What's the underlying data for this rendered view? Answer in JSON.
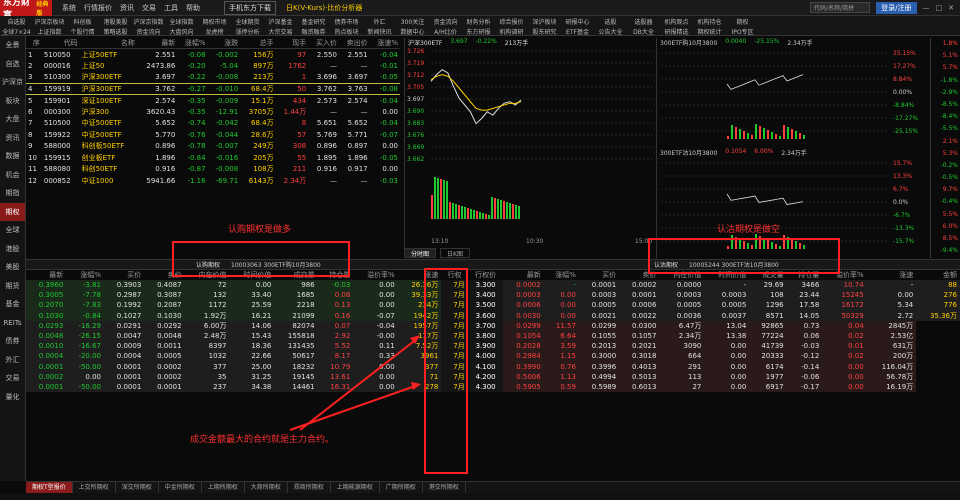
{
  "app": {
    "logo": "东方财富",
    "edition": "经典版",
    "menu": [
      "系统",
      "行情报价",
      "资讯",
      "交易",
      "工具",
      "帮助"
    ],
    "mobile": "手机东方下载",
    "promo": "日K(V-Kurs)·比价分析器",
    "search_placeholder": "代码/名称/简拼",
    "login": "登录/注册"
  },
  "toolbar": {
    "row1": [
      "自选股",
      "沪深京板块",
      "科创板",
      "港股美股",
      "沪深京指数",
      "全球指数",
      "期权市场",
      "全球期货",
      "沪深基金",
      "基金研究",
      "债券市场",
      "外汇",
      "300关注",
      "资金流向",
      "财务分析",
      "综合报价",
      "深沪板块",
      "研报中心",
      "选股",
      "选股器",
      "机构观点",
      "机构持仓",
      "期权"
    ],
    "row2": [
      "全球7×24",
      "上证指数",
      "个股行情",
      "策略选股",
      "资金流向",
      "大盘风向",
      "龙虎榜",
      "涨停分析",
      "大宗交易",
      "融资融券",
      "热点板块",
      "新闻快讯",
      "数据中心",
      "A/H比价",
      "东方研报",
      "机构调研",
      "股东研究",
      "ETF基金",
      "公告大全",
      "DB大全",
      "研报精选",
      "期权统计",
      "IPO专区"
    ]
  },
  "sidebar": [
    "全景",
    "自选",
    "沪深京",
    "板块",
    "大盘",
    "资讯",
    "数据",
    "机会",
    "期指",
    "期权",
    "全球",
    "港股",
    "美股",
    "期货",
    "基金",
    "REITs",
    "债券",
    "外汇",
    "交易",
    "量化"
  ],
  "watchlist": {
    "columns": [
      "序",
      "代码",
      "名称",
      "最新",
      "涨幅%",
      "涨跌",
      "总手",
      "现手",
      "买入价",
      "卖出价",
      "涨速%"
    ],
    "rows": [
      {
        "no": "1",
        "code": "510050",
        "name": "上证50ETF",
        "price": "2.551",
        "pct": "-0.08",
        "chg": "-0.002",
        "vol": "156万",
        "cur": "97",
        "bid": "2.550",
        "ask": "2.551",
        "spd": "-0.04",
        "dir": "dn"
      },
      {
        "no": "2",
        "code": "000016",
        "name": "上证50",
        "price": "2473.86",
        "pct": "-0.20",
        "chg": "-5.04",
        "vol": "897万",
        "cur": "1762",
        "bid": "—",
        "ask": "—",
        "spd": "-0.01",
        "dir": "dn"
      },
      {
        "no": "3",
        "code": "510300",
        "name": "沪深300ETF",
        "price": "3.697",
        "pct": "-0.22",
        "chg": "-0.008",
        "vol": "213万",
        "cur": "1",
        "bid": "3.696",
        "ask": "3.697",
        "spd": "-0.05",
        "dir": "dn"
      },
      {
        "no": "4",
        "code": "159919",
        "name": "沪深300ETF",
        "price": "3.762",
        "pct": "-0.27",
        "chg": "-0.010",
        "vol": "68.4万",
        "cur": "50",
        "bid": "3.762",
        "ask": "3.763",
        "spd": "-0.08",
        "dir": "dn"
      },
      {
        "no": "5",
        "code": "159901",
        "name": "深证100ETF",
        "price": "2.574",
        "pct": "-0.35",
        "chg": "-0.009",
        "vol": "15.1万",
        "cur": "434",
        "bid": "2.573",
        "ask": "2.574",
        "spd": "-0.04",
        "dir": "dn"
      },
      {
        "no": "6",
        "code": "000300",
        "name": "沪深300",
        "price": "3620.43",
        "pct": "-0.35",
        "chg": "-12.91",
        "vol": "3705万",
        "cur": "1.44万",
        "bid": "—",
        "ask": "—",
        "spd": "0.00",
        "dir": "dn"
      },
      {
        "no": "7",
        "code": "510500",
        "name": "中证500ETF",
        "price": "5.652",
        "pct": "-0.74",
        "chg": "-0.042",
        "vol": "68.4万",
        "cur": "8",
        "bid": "5.651",
        "ask": "5.652",
        "spd": "-0.04",
        "dir": "dn"
      },
      {
        "no": "8",
        "code": "159922",
        "name": "中证500ETF",
        "price": "5.770",
        "pct": "-0.76",
        "chg": "-0.044",
        "vol": "28.6万",
        "cur": "57",
        "bid": "5.769",
        "ask": "5.771",
        "spd": "-0.07",
        "dir": "dn"
      },
      {
        "no": "9",
        "code": "588000",
        "name": "科创板50ETF",
        "price": "0.896",
        "pct": "-0.78",
        "chg": "-0.007",
        "vol": "249万",
        "cur": "308",
        "bid": "0.896",
        "ask": "0.897",
        "spd": "0.00",
        "dir": "dn"
      },
      {
        "no": "10",
        "code": "159915",
        "name": "创业板ETF",
        "price": "1.896",
        "pct": "-0.84",
        "chg": "-0.016",
        "vol": "205万",
        "cur": "55",
        "bid": "1.895",
        "ask": "1.896",
        "spd": "-0.05",
        "dir": "dn"
      },
      {
        "no": "11",
        "code": "588080",
        "name": "科创50ETF",
        "price": "0.916",
        "pct": "-0.87",
        "chg": "-0.008",
        "vol": "108万",
        "cur": "211",
        "bid": "0.916",
        "ask": "0.917",
        "spd": "0.00",
        "dir": "dn"
      },
      {
        "no": "12",
        "code": "000852",
        "name": "中证1000",
        "price": "5941.66",
        "pct": "-1.16",
        "chg": "-69.71",
        "vol": "6143万",
        "cur": "2.34万",
        "bid": "—",
        "ask": "—",
        "spd": "-0.03",
        "dir": "dn"
      }
    ]
  },
  "mini_chart": {
    "header": [
      "沪深300ETF",
      "3.697",
      "-0.22%",
      "213万手"
    ],
    "yticks": [
      "3.726",
      "3.719",
      "3.712",
      "3.705",
      "3.697",
      "3.690",
      "3.683",
      "3.676",
      "3.669",
      "3.662"
    ],
    "xticks": [
      "13:10",
      "10:30",
      "15:00"
    ],
    "tabs": [
      "分时图",
      "日K图"
    ],
    "chart_data": {
      "type": "line",
      "series": [
        {
          "values": [
            3.708,
            3.712,
            3.715,
            3.713,
            3.705,
            3.698,
            3.694,
            3.69,
            3.683,
            3.686,
            3.69,
            3.688,
            3.692,
            3.695,
            3.696,
            3.694,
            3.697
          ]
        },
        {
          "values": [
            3.709,
            3.711,
            3.712,
            3.711,
            3.708,
            3.704,
            3.7,
            3.696,
            3.692,
            3.691,
            3.691,
            3.692,
            3.693,
            3.694,
            3.695,
            3.695,
            3.696
          ]
        }
      ]
    }
  },
  "opt_call": {
    "header": [
      "300ETF购10月3800",
      "0.0040",
      "-25.15%",
      "2.34万手"
    ],
    "rticks": [
      "25.15%",
      "17.27%",
      "8.84%",
      "0.00%",
      "-8.84%",
      "-17.27%",
      "-25.15%"
    ]
  },
  "opt_put": {
    "header": [
      "300ETF沽10月3800",
      "0.1054",
      "6.00%",
      "2.34万手"
    ],
    "rticks": [
      "15.7%",
      "13.3%",
      "6.7%",
      "0.0%",
      "-6.7%",
      "-13.3%",
      "-15.7%"
    ]
  },
  "right_strip": [
    "1.8%",
    "5.1%",
    "5.7%",
    "-1.8%",
    "-2.9%",
    "-8.5%",
    "-8.4%",
    "-5.5%",
    "2.1%",
    "5.3%",
    "-0.2%",
    "-0.5%",
    "9.7%",
    "-0.4%",
    "5.5%",
    "6.0%",
    "8.5%",
    "-9.4%"
  ],
  "tip": {
    "left_label": "认购期权",
    "left_sub": "10003063  300ETF购10月3800",
    "right_label": "认沽期权",
    "right_sub": "10005244  300ETF沽10月3800"
  },
  "chain": {
    "columns_call": [
      "最新",
      "涨幅%",
      "买价",
      "卖价",
      "内在价值",
      "时间价值",
      "成交量",
      "持仓量",
      "溢价率%",
      "涨速",
      "金额"
    ],
    "columns_mid": [
      "行权",
      "行权价"
    ],
    "columns_put": [
      "最新",
      "涨幅%",
      "买价",
      "卖价",
      "内在价值",
      "时间价值",
      "成交量",
      "持仓量",
      "溢价率%",
      "涨速",
      "金额"
    ],
    "rows": [
      {
        "c": [
          "0.3960",
          "-3.81",
          "0.3903",
          "0.4087",
          "72",
          "0.00",
          "986",
          "-0.03",
          "0.00",
          "26.36万"
        ],
        "m": [
          "7月",
          "3.300"
        ],
        "p": [
          "0.0002",
          "-",
          "0.0001",
          "0.0002",
          "0.0000",
          "-",
          "29.69",
          "3466",
          "10.74",
          "-",
          "88"
        ],
        "cls": "itm"
      },
      {
        "c": [
          "0.3005",
          "-7.78",
          "0.2987",
          "0.3087",
          "132",
          "33.40",
          "1685",
          "0.08",
          "0.00",
          "39.33万"
        ],
        "m": [
          "7月",
          "3.400"
        ],
        "p": [
          "0.0003",
          "0.00",
          "0.0003",
          "0.0001",
          "0.0003",
          "0.0003",
          "108",
          "23.44",
          "15245",
          "0.00",
          "276"
        ],
        "cls": "itm"
      },
      {
        "c": [
          "0.2070",
          "-7.83",
          "0.1992",
          "0.2087",
          "1172",
          "25.59",
          "2218",
          "0.13",
          "0.00",
          "234万"
        ],
        "m": [
          "7月",
          "3.500"
        ],
        "p": [
          "0.0006",
          "0.00",
          "0.0005",
          "0.0006",
          "0.0005",
          "0.0005",
          "1296",
          "17.58",
          "16172",
          "5.34",
          "776"
        ],
        "cls": "itm"
      },
      {
        "c": [
          "0.1030",
          "-0.84",
          "0.1027",
          "0.1030",
          "1.92万",
          "16.21",
          "21099",
          "0.16",
          "-0.07",
          "1942万"
        ],
        "m": [
          "7月",
          "3.600"
        ],
        "p": [
          "0.0030",
          "0.00",
          "0.0021",
          "0.0022",
          "0.0036",
          "0.0037",
          "8571",
          "14.05",
          "50329",
          "2.72",
          "35.36万"
        ],
        "cls": "itm"
      },
      {
        "c": [
          "0.0293",
          "-16.29",
          "0.0291",
          "0.0292",
          "6.00万",
          "14.06",
          "82074",
          "0.07",
          "-0.04",
          "1957万"
        ],
        "m": [
          "7月",
          "3.700"
        ],
        "p": [
          "0.0299",
          "11.57",
          "0.0299",
          "0.0300",
          "6.47万",
          "13.04",
          "92865",
          "0.73",
          "0.04",
          "2845万"
        ],
        "cls": "otm"
      },
      {
        "c": [
          "0.0048",
          "-26.15",
          "0.0047",
          "0.0048",
          "2.48万",
          "15.43",
          "155818",
          "2.92",
          "-0.00",
          "117万"
        ],
        "m": [
          "7月",
          "3.800"
        ],
        "p": [
          "0.1054",
          "6.64",
          "0.1055",
          "0.1057",
          "2.34万",
          "13.38",
          "77224",
          "0.06",
          "0.02",
          "2.53亿"
        ],
        "cls": "otm"
      },
      {
        "c": [
          "0.0010",
          "-16.67",
          "0.0009",
          "0.0011",
          "8397",
          "18.36",
          "131435",
          "5.52",
          "0.11",
          "7.52万"
        ],
        "m": [
          "7月",
          "3.900"
        ],
        "p": [
          "0.2028",
          "3.59",
          "0.2013",
          "0.2021",
          "3090",
          "0.00",
          "41739",
          "-0.03",
          "0.01",
          "631万"
        ],
        "cls": "otm"
      },
      {
        "c": [
          "0.0004",
          "-20.00",
          "0.0004",
          "0.0005",
          "1032",
          "22.66",
          "50617",
          "8.17",
          "0.33",
          "3961"
        ],
        "m": [
          "7月",
          "4.000"
        ],
        "p": [
          "0.2984",
          "1.15",
          "0.3000",
          "0.3018",
          "664",
          "0.00",
          "20333",
          "-0.12",
          "0.02",
          "200万"
        ],
        "cls": "otm"
      },
      {
        "c": [
          "0.0001",
          "-50.00",
          "0.0001",
          "0.0002",
          "377",
          "25.00",
          "18232",
          "10.79",
          "0.00",
          "377"
        ],
        "m": [
          "7月",
          "4.100"
        ],
        "p": [
          "0.3990",
          "0.76",
          "0.3996",
          "0.4013",
          "291",
          "0.00",
          "6174",
          "-0.14",
          "0.00",
          "116.04万"
        ],
        "cls": "otm"
      },
      {
        "c": [
          "0.0002",
          "0.00",
          "0.0001",
          "0.0002",
          "35",
          "31.25",
          "19145",
          "13.61",
          "0.00",
          "71"
        ],
        "m": [
          "7月",
          "4.200"
        ],
        "p": [
          "0.5006",
          "1.13",
          "0.4994",
          "0.5013",
          "113",
          "0.00",
          "1977",
          "-0.06",
          "0.00",
          "56.78万"
        ],
        "cls": "otm"
      },
      {
        "c": [
          "0.0001",
          "-50.00",
          "0.0001",
          "0.0001",
          "237",
          "34.38",
          "14461",
          "16.31",
          "0.00",
          "278"
        ],
        "m": [
          "7月",
          "4.300"
        ],
        "p": [
          "0.5905",
          "0.59",
          "0.5989",
          "0.6013",
          "27",
          "0.00",
          "6917",
          "-0.17",
          "0.00",
          "16.19万"
        ],
        "cls": "otm"
      }
    ]
  },
  "bottom_tabs": [
    "期权T型报价",
    "上交所期权",
    "深交所期权",
    "中金所期权",
    "上期所期权",
    "大商所期权",
    "郑商所期权",
    "上期能源期权",
    "广期所期权",
    "港交所期权"
  ],
  "annotations": {
    "call_note": "认购期权是做多",
    "put_note": "认沽期权是做空",
    "main_note": "成交金额最大的合约就是主力合约。"
  }
}
